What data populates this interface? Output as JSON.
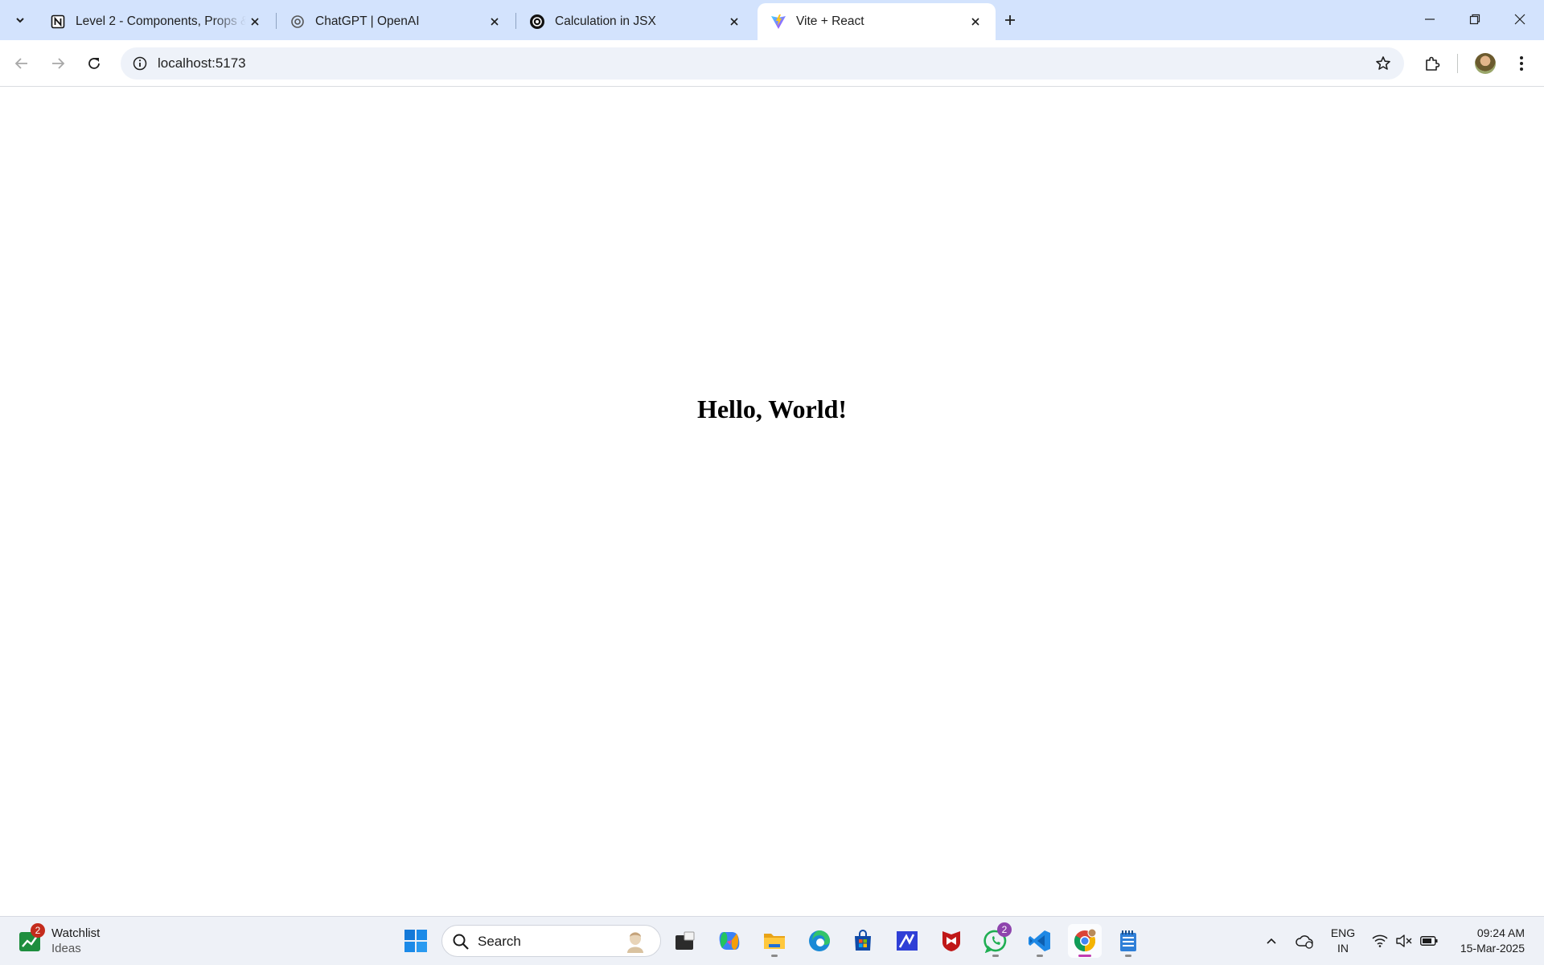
{
  "browser": {
    "tabs": [
      {
        "title": "Level 2 - Components, Props &",
        "favicon": "notion-icon",
        "active": false
      },
      {
        "title": "ChatGPT | OpenAI",
        "favicon": "openai-icon",
        "active": false
      },
      {
        "title": "Calculation in JSX",
        "favicon": "openai-icon",
        "active": false
      },
      {
        "title": "Vite + React",
        "favicon": "vite-icon",
        "active": true
      }
    ],
    "address": "localhost:5173",
    "accent": "#d3e3fd"
  },
  "page": {
    "heading": "Hello, World!"
  },
  "taskbar": {
    "widget": {
      "title": "Watchlist",
      "subtitle": "Ideas",
      "badge": "2"
    },
    "search_placeholder": "Search",
    "apps": [
      "start-icon",
      "file-manager-icon",
      "copilot-icon",
      "file-explorer-icon",
      "edge-icon",
      "store-icon",
      "app-icon",
      "mcafee-icon",
      "whatsapp-icon",
      "vscode-icon",
      "chrome-icon",
      "notepad-icon"
    ],
    "whatsapp_badge": "2",
    "language": {
      "line1": "ENG",
      "line2": "IN"
    },
    "clock": {
      "time": "09:24 AM",
      "date": "15-Mar-2025"
    }
  }
}
